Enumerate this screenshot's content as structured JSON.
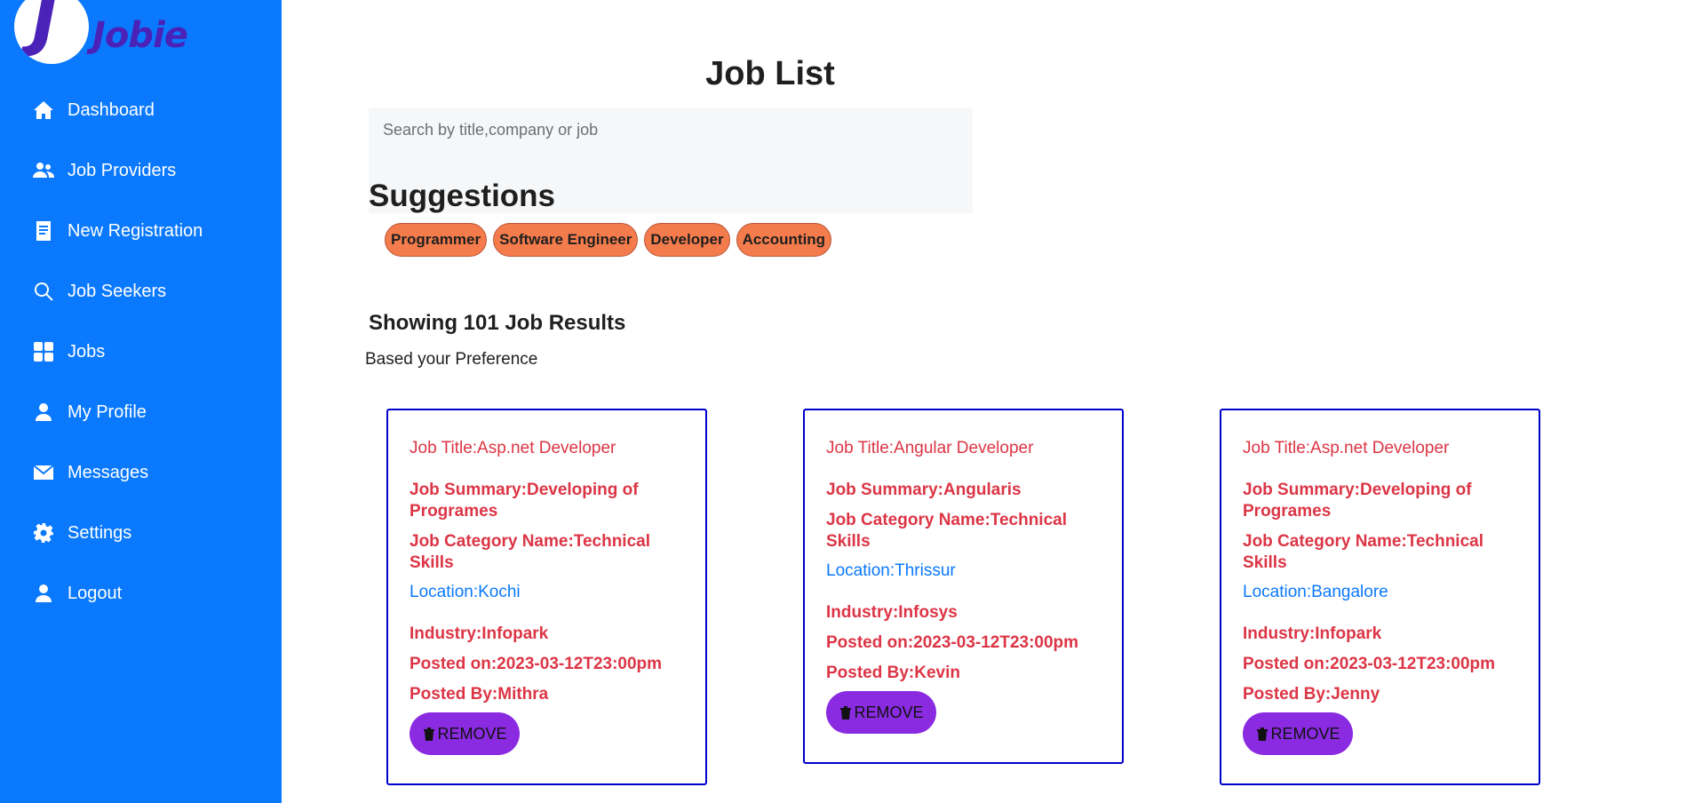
{
  "brand": {
    "letter": "J",
    "name": "Jobie"
  },
  "nav": [
    {
      "label": "Dashboard",
      "icon": "home-icon"
    },
    {
      "label": "Job Providers",
      "icon": "users-icon"
    },
    {
      "label": "New Registration",
      "icon": "document-icon"
    },
    {
      "label": "Job Seekers",
      "icon": "search-icon"
    },
    {
      "label": "Jobs",
      "icon": "grid-icon"
    },
    {
      "label": "My Profile",
      "icon": "user-icon"
    },
    {
      "label": "Messages",
      "icon": "envelope-icon"
    },
    {
      "label": "Settings",
      "icon": "gear-icon"
    },
    {
      "label": "Logout",
      "icon": "user-icon"
    }
  ],
  "page": {
    "title": "Job List",
    "search_placeholder": "Search by title,company or job",
    "suggestions_title": "Suggestions",
    "suggestions": [
      "Programmer",
      "Software Engineer",
      "Developer",
      "Accounting"
    ],
    "results_title": "Showing 101 Job Results",
    "results_subtitle": "Based your Preference"
  },
  "colors": {
    "sidebar": "#0a79fd",
    "chip": "#f47c4c",
    "card_border": "#0000cc",
    "card_text": "#dc3545",
    "location": "#0a79fd",
    "remove_button": "#8a2be2"
  },
  "jobs": [
    {
      "title": "Job Title:Asp.net Developer",
      "summary": "Job Summary:Developing of Programes",
      "category": "Job Category Name:Technical Skills",
      "location": "Location:Kochi",
      "industry": "Industry:Infopark",
      "posted_on": "Posted on:2023-03-12T23:00pm",
      "posted_by": "Posted By:Mithra",
      "remove_label": "REMOVE"
    },
    {
      "title": "Job Title:Angular Developer",
      "summary": "Job Summary:Angularis",
      "category": "Job Category Name:Technical Skills",
      "location": "Location:Thrissur",
      "industry": "Industry:Infosys",
      "posted_on": "Posted on:2023-03-12T23:00pm",
      "posted_by": "Posted By:Kevin",
      "remove_label": "REMOVE"
    },
    {
      "title": "Job Title:Asp.net Developer",
      "summary": "Job Summary:Developing of Programes",
      "category": "Job Category Name:Technical Skills",
      "location": "Location:Bangalore",
      "industry": "Industry:Infopark",
      "posted_on": "Posted on:2023-03-12T23:00pm",
      "posted_by": "Posted By:Jenny",
      "remove_label": "REMOVE"
    }
  ]
}
